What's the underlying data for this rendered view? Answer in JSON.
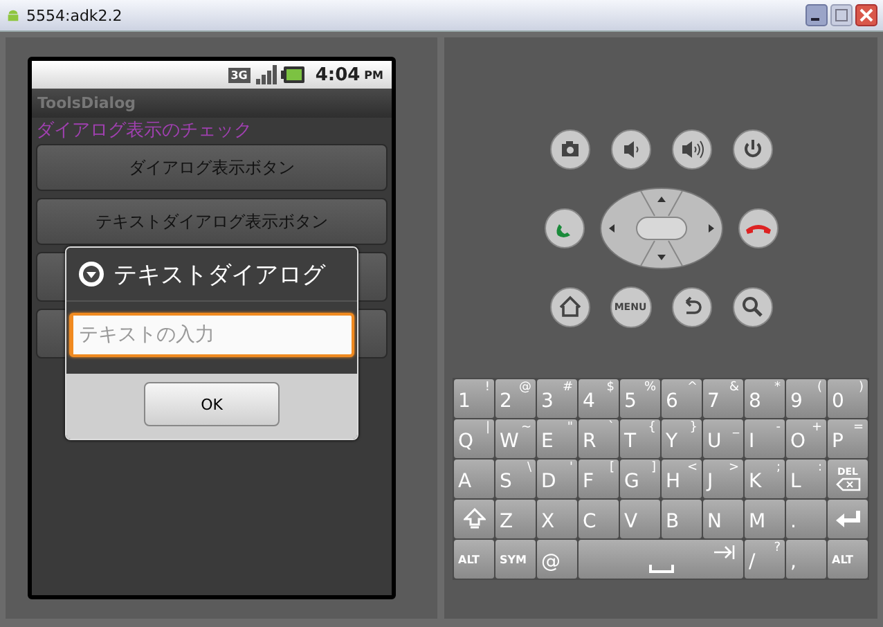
{
  "window": {
    "title": "5554:adk2.2"
  },
  "status_bar": {
    "time": "4:04",
    "ampm": "PM",
    "network": "3G"
  },
  "app": {
    "title": "ToolsDialog",
    "heading": "ダイアログ表示のチェック",
    "buttons": [
      {
        "label": "ダイアログ表示ボタン"
      },
      {
        "label": "テキストダイアログ表示ボタン"
      }
    ]
  },
  "dialog": {
    "title": "テキストダイアログ",
    "input": {
      "placeholder": "テキストの入力",
      "focused": true
    },
    "ok": "OK"
  },
  "controls": {
    "menu_label": "MENU"
  },
  "keyboard": [
    [
      {
        "kind": "char",
        "main": "1",
        "alt": "!"
      },
      {
        "kind": "char",
        "main": "2",
        "alt": "@"
      },
      {
        "kind": "char",
        "main": "3",
        "alt": "#"
      },
      {
        "kind": "char",
        "main": "4",
        "alt": "$"
      },
      {
        "kind": "char",
        "main": "5",
        "alt": "%"
      },
      {
        "kind": "char",
        "main": "6",
        "alt": "^"
      },
      {
        "kind": "char",
        "main": "7",
        "alt": "&"
      },
      {
        "kind": "char",
        "main": "8",
        "alt": "*"
      },
      {
        "kind": "char",
        "main": "9",
        "alt": "("
      },
      {
        "kind": "char",
        "main": "0",
        "alt": ")"
      }
    ],
    [
      {
        "kind": "char",
        "main": "Q",
        "alt": "|"
      },
      {
        "kind": "char",
        "main": "W",
        "alt": "~"
      },
      {
        "kind": "char",
        "main": "E",
        "alt": "\""
      },
      {
        "kind": "char",
        "main": "R",
        "alt": "`"
      },
      {
        "kind": "char",
        "main": "T",
        "alt": "{"
      },
      {
        "kind": "char",
        "main": "Y",
        "alt": "}"
      },
      {
        "kind": "char",
        "main": "U",
        "alt": "_"
      },
      {
        "kind": "char",
        "main": "I",
        "alt": "-"
      },
      {
        "kind": "char",
        "main": "O",
        "alt": "+"
      },
      {
        "kind": "char",
        "main": "P",
        "alt": "="
      }
    ],
    [
      {
        "kind": "char",
        "main": "A"
      },
      {
        "kind": "char",
        "main": "S",
        "alt": "\\"
      },
      {
        "kind": "char",
        "main": "D",
        "alt": "'"
      },
      {
        "kind": "char",
        "main": "F",
        "alt": "["
      },
      {
        "kind": "char",
        "main": "G",
        "alt": "]"
      },
      {
        "kind": "char",
        "main": "H",
        "alt": "<"
      },
      {
        "kind": "char",
        "main": "J",
        "alt": ">"
      },
      {
        "kind": "char",
        "main": "K",
        "alt": ";"
      },
      {
        "kind": "char",
        "main": "L",
        "alt": ":"
      },
      {
        "kind": "del",
        "main": "DEL"
      }
    ],
    [
      {
        "kind": "shift"
      },
      {
        "kind": "char",
        "main": "Z"
      },
      {
        "kind": "char",
        "main": "X"
      },
      {
        "kind": "char",
        "main": "C"
      },
      {
        "kind": "char",
        "main": "V"
      },
      {
        "kind": "char",
        "main": "B"
      },
      {
        "kind": "char",
        "main": "N"
      },
      {
        "kind": "char",
        "main": "M"
      },
      {
        "kind": "char",
        "main": "."
      },
      {
        "kind": "enter"
      }
    ],
    [
      {
        "kind": "small",
        "main": "ALT"
      },
      {
        "kind": "small",
        "main": "SYM"
      },
      {
        "kind": "char",
        "main": "@"
      },
      {
        "kind": "space"
      },
      {
        "kind": "char",
        "main": "/",
        "alt": "?"
      },
      {
        "kind": "char",
        "main": ","
      },
      {
        "kind": "small",
        "main": "ALT"
      }
    ]
  ]
}
